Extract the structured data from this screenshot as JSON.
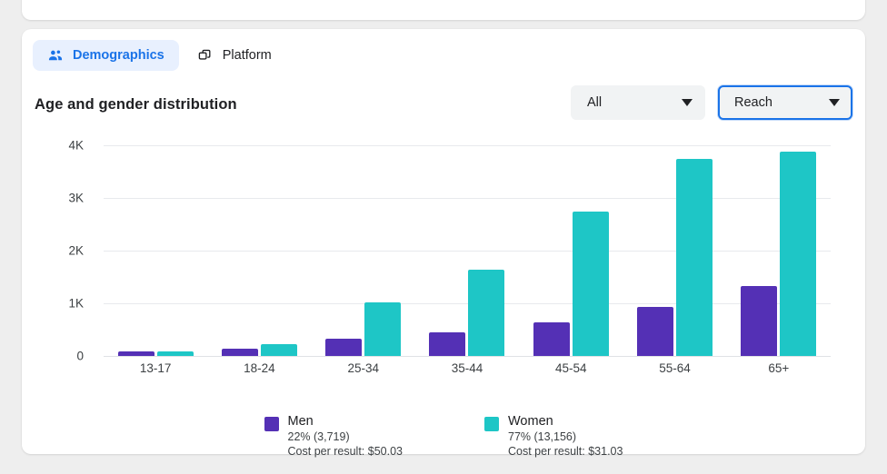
{
  "tabs": [
    {
      "label": "Demographics",
      "icon": "people-icon",
      "active": true
    },
    {
      "label": "Platform",
      "icon": "layers-icon",
      "active": false
    }
  ],
  "header": {
    "title": "Age and gender distribution"
  },
  "controls": {
    "breakdown": {
      "value": "All",
      "name": "breakdown-select"
    },
    "metric": {
      "value": "Reach",
      "name": "metric-select",
      "focused": true
    }
  },
  "colors": {
    "men": "#5430B5",
    "women": "#1EC6C6",
    "accent": "#1a73e8",
    "tab_active_bg": "#e8f0fe",
    "grid": "#e8eaed"
  },
  "legend": [
    {
      "name": "Men",
      "color": "#5430B5",
      "share": "22% (3,719)",
      "cost": "Cost per result: $50.03"
    },
    {
      "name": "Women",
      "color": "#1EC6C6",
      "share": "77% (13,156)",
      "cost": "Cost per result: $31.03"
    }
  ],
  "chart_data": {
    "type": "bar",
    "title": "Age and gender distribution",
    "xlabel": "",
    "ylabel": "",
    "ylim": [
      0,
      4000
    ],
    "yticks": [
      0,
      1000,
      2000,
      3000,
      4000
    ],
    "ytick_labels": [
      "0",
      "1K",
      "2K",
      "3K",
      "4K"
    ],
    "grid": true,
    "legend_position": "bottom-center",
    "categories": [
      "13-17",
      "18-24",
      "25-34",
      "35-44",
      "45-54",
      "55-64",
      "65+"
    ],
    "series": [
      {
        "name": "Men",
        "color": "#5430B5",
        "values": [
          90,
          140,
          330,
          455,
          640,
          930,
          1330
        ]
      },
      {
        "name": "Women",
        "color": "#1EC6C6",
        "values": [
          80,
          230,
          1010,
          1640,
          2750,
          3745,
          3875
        ]
      }
    ]
  }
}
